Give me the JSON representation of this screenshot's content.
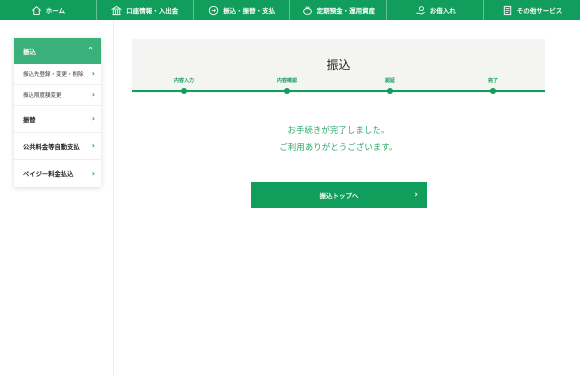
{
  "nav": [
    {
      "icon": "home-icon",
      "label": "ホーム"
    },
    {
      "icon": "bank-account-icon",
      "label": "口座情報・入出金"
    },
    {
      "icon": "transfer-icon",
      "label": "振込・振替・支払"
    },
    {
      "icon": "savings-pot-icon",
      "label": "定期預金・運用資産"
    },
    {
      "icon": "loan-hand-icon",
      "label": "お借入れ"
    },
    {
      "icon": "other-services-icon",
      "label": "その他サービス"
    }
  ],
  "sidebar": {
    "head": "振込",
    "subs": [
      "振込先登録・変更・削除",
      "振込限度額変更"
    ],
    "mains": [
      "振替",
      "公共料金等自動支払",
      "ペイジー料金払込"
    ]
  },
  "card": {
    "title": "振込",
    "steps": [
      "内容入力",
      "内容確認",
      "認証",
      "完了"
    ]
  },
  "message": {
    "line1": "お手続きが完了しました。",
    "line2": "ご利用ありがとうございます。"
  },
  "button": {
    "label": "振込トップへ"
  },
  "colors": {
    "primary": "#119d5b",
    "sidebar_active": "#3ab17a",
    "message": "#2aa66a"
  }
}
